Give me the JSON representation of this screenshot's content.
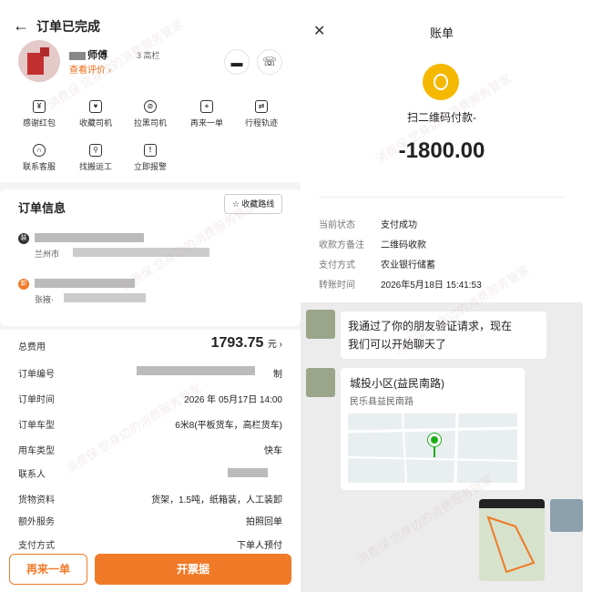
{
  "order": {
    "title": "订单已完成",
    "driver_name": "师傅",
    "driver_tag": "3 高栏",
    "review_link": "查看评价 ›",
    "actions": [
      "感谢红包",
      "收藏司机",
      "拉黑司机",
      "再来一单",
      "行程轨迹",
      "联系客服",
      "找搬运工",
      "立即报警"
    ],
    "info_title": "订单信息",
    "fav_route": "☆ 收藏路线",
    "start_city": "兰州市",
    "end_name": "张掖·",
    "rows": [
      {
        "k": "订单编号",
        "v": "制"
      },
      {
        "k": "订单时间",
        "v": "2026 年 05月17日 14:00"
      },
      {
        "k": "订单车型",
        "v": "6米8(平板货车，高栏货车)"
      },
      {
        "k": "用车类型",
        "v": "快车"
      },
      {
        "k": "联系人",
        "v": ""
      },
      {
        "k": "货物资料",
        "v": "货架，1.5吨，纸箱装，人工装卸"
      },
      {
        "k": "额外服务",
        "v": "拍照回单"
      },
      {
        "k": "支付方式",
        "v": "下单人预付"
      }
    ],
    "total_label": "总费用",
    "total_value": "1793.75",
    "total_unit": "元 ›",
    "btn_again": "再来一单",
    "btn_invoice": "开票据"
  },
  "bill": {
    "title": "账单",
    "payee": "扫二维码付款-",
    "amount": "-1800.00",
    "details": [
      {
        "k": "当前状态",
        "v": "支付成功"
      },
      {
        "k": "收款方备注",
        "v": "二维码收款"
      },
      {
        "k": "支付方式",
        "v": "农业银行储蓄"
      },
      {
        "k": "转账时间",
        "v": "2026年5月18日 15:41:53"
      }
    ]
  },
  "chat": {
    "msg1_line1": "我通过了你的朋友验证请求，现在",
    "msg1_line2": "我们可以开始聊天了",
    "map_title": "城投小区(益民南路)",
    "map_sub": "民乐县益民南路"
  },
  "watermark": "消费保 您身边的消费服务管家",
  "colors": {
    "accent": "#f07a28",
    "pay": "#f5b800",
    "pin": "#1aad19"
  }
}
